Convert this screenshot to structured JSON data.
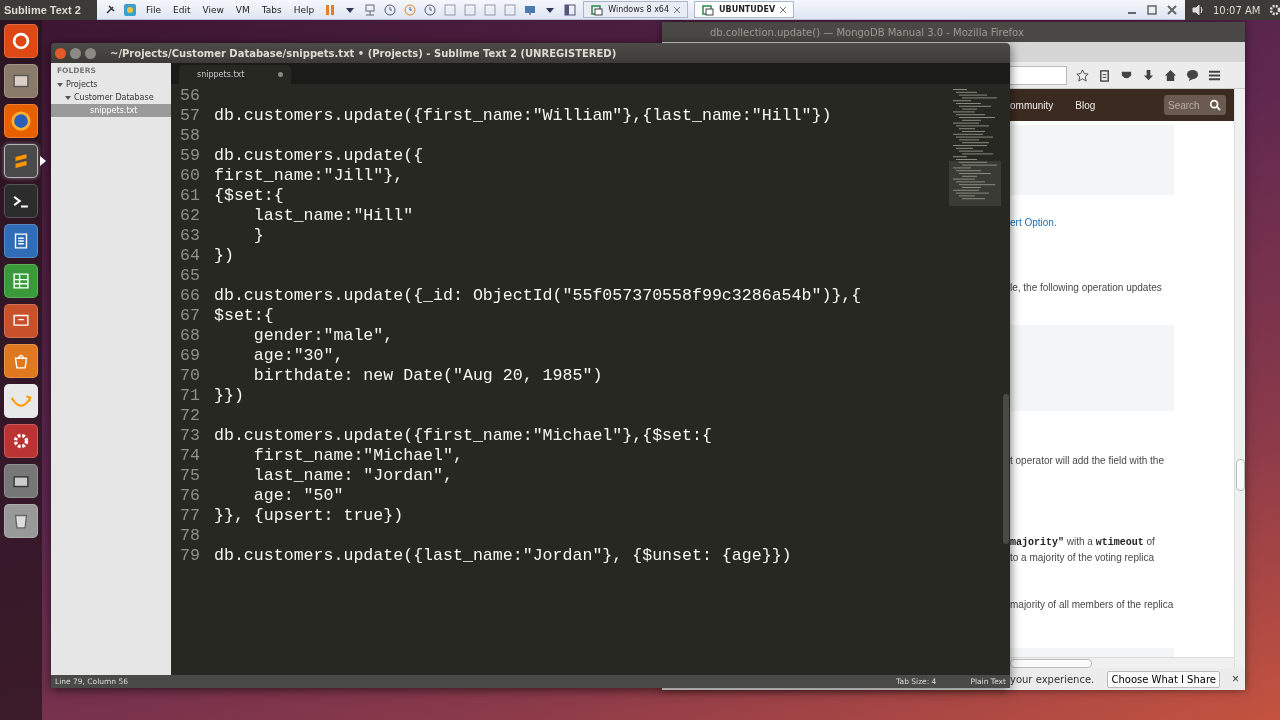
{
  "top_panel": {
    "app_name": "Sublime Text 2",
    "clock": "10:07 AM"
  },
  "vm_toolbar": {
    "menus": [
      "File",
      "Edit",
      "View",
      "VM",
      "Tabs",
      "Help"
    ],
    "tabs": [
      {
        "label": "Windows 8 x64",
        "selected": false
      },
      {
        "label": "UBUNTUDEV",
        "selected": true
      }
    ]
  },
  "launcher": [
    {
      "kind": "home",
      "focused": false
    },
    {
      "kind": "files",
      "focused": false
    },
    {
      "kind": "browser",
      "focused": false
    },
    {
      "kind": "editor",
      "focused": true
    },
    {
      "kind": "terminal",
      "focused": false
    },
    {
      "kind": "writer",
      "focused": false
    },
    {
      "kind": "calc",
      "focused": false
    },
    {
      "kind": "impress",
      "focused": false
    },
    {
      "kind": "software",
      "focused": false
    },
    {
      "kind": "amazon",
      "focused": false
    },
    {
      "kind": "settings",
      "focused": false
    },
    {
      "kind": "drive",
      "focused": false
    },
    {
      "kind": "trash",
      "focused": false
    }
  ],
  "firefox": {
    "title": "db.collection.update() — MongoDB Manual 3.0 - Mozilla Firefox",
    "nav": [
      "ommunity",
      "Blog"
    ],
    "search": {
      "placeholder": "Search"
    },
    "content": [
      {
        "kind": "code-block"
      },
      {
        "kind": "link",
        "text": "ert Option."
      },
      {
        "kind": "text",
        "text": "le, the following operation updates"
      },
      {
        "kind": "code-block"
      },
      {
        "kind": "text",
        "text": "t operator will add the field with the"
      },
      {
        "kind": "text",
        "text": "**majority\"** with a **wtimeout** of"
      },
      {
        "kind": "text",
        "text": "to a majority of the voting replica"
      },
      {
        "kind": "text",
        "text": "majority of all members of the replica"
      },
      {
        "kind": "code-block"
      }
    ],
    "notice": {
      "text": "your experience.",
      "button": "Choose What I Share",
      "close": "×"
    }
  },
  "sublime": {
    "title": "~/Projects/Customer Database/snippets.txt • (Projects) - Sublime Text 2 (UNREGISTERED)",
    "sidebar": {
      "heading": "FOLDERS",
      "items": [
        {
          "label": "Projects",
          "expanded": true,
          "selected": false,
          "children": [
            {
              "label": "Customer Database",
              "expanded": true,
              "selected": false,
              "children": [
                {
                  "label": "snippets.txt",
                  "selected": true
                }
              ]
            }
          ]
        }
      ]
    },
    "tabs": [
      {
        "label": "snippets.txt",
        "modified": true,
        "selected": true
      }
    ],
    "lines": [
      {
        "number": "56"
      },
      {
        "number": "57",
        "text": "db.customers.update({first_name:\"William\"},{last_name:\"Hill\"})"
      },
      {
        "number": "58"
      },
      {
        "number": "59",
        "text": "db.customers.update({"
      },
      {
        "number": "60",
        "text": "first_name:\"Jill\"},"
      },
      {
        "number": "61",
        "text": "{$set:{"
      },
      {
        "number": "62",
        "text": "    last_name:\"Hill\""
      },
      {
        "number": "63",
        "text": "    }"
      },
      {
        "number": "64",
        "text": "})"
      },
      {
        "number": "65"
      },
      {
        "number": "66",
        "text": "db.customers.update({_id: ObjectId(\"55f057370558f99c3286a54b\")},{"
      },
      {
        "number": "67",
        "text": "$set:{"
      },
      {
        "number": "68",
        "text": "    gender:\"male\","
      },
      {
        "number": "69",
        "text": "    age:\"30\","
      },
      {
        "number": "70",
        "text": "    birthdate: new Date(\"Aug 20, 1985\")"
      },
      {
        "number": "71",
        "text": "}})"
      },
      {
        "number": "72"
      },
      {
        "number": "73",
        "text": "db.customers.update({first_name:\"Michael\"},{$set:{"
      },
      {
        "number": "74",
        "text": "    first_name:\"Michael\","
      },
      {
        "number": "75",
        "text": "    last_name: \"Jordan\","
      },
      {
        "number": "76",
        "text": "    age: \"50\""
      },
      {
        "number": "77",
        "text": "}}, {upsert: true})"
      },
      {
        "number": "78"
      },
      {
        "number": "79",
        "text": "db.customers.update({last_name:\"Jordan\"}, {$unset: {age}})"
      }
    ],
    "status": {
      "position": "Line 79, Column 56",
      "tab_size": "Tab Size: 4",
      "syntax": "Plain Text"
    }
  }
}
